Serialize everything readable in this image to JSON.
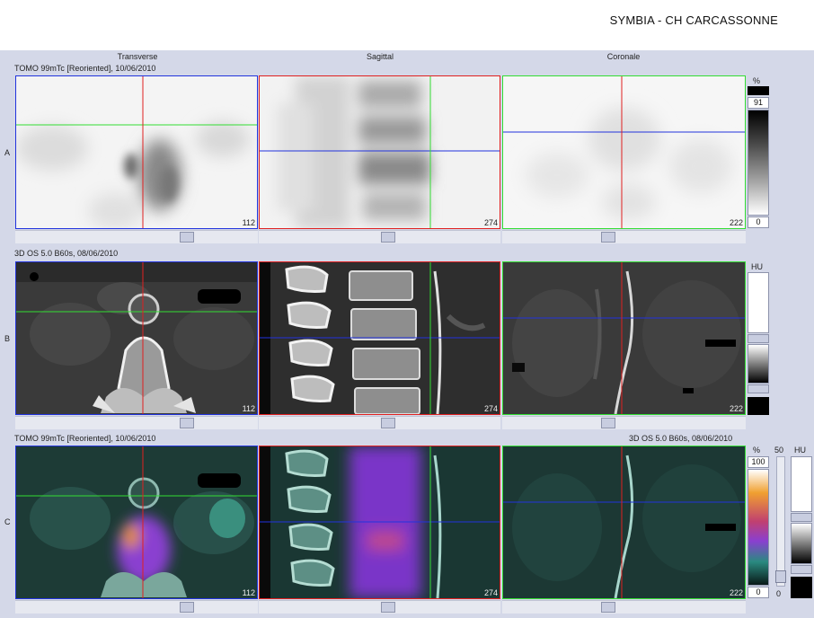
{
  "header": {
    "hospital": "SYMBIA - CH CARCASSONNE"
  },
  "columns": [
    "Transverse",
    "Sagittal",
    "Coronale"
  ],
  "rows": [
    {
      "label": "A",
      "series_left": "TOMO 99mTc [Reoriented], 10/06/2010",
      "series_right": "",
      "slices": [
        "112",
        "274",
        "222"
      ],
      "scale_unit": "%",
      "scale_top": "91",
      "scale_bottom": "0"
    },
    {
      "label": "B",
      "series_left": "3D  OS  5.0  B60s, 08/06/2010",
      "series_right": "",
      "slices": [
        "112",
        "274",
        "222"
      ],
      "scale_unit": "HU"
    },
    {
      "label": "C",
      "series_left": "TOMO 99mTc [Reoriented], 10/06/2010",
      "series_right": "3D  OS  5.0  B60s, 08/06/2010",
      "slices": [
        "112",
        "274",
        "222"
      ],
      "scale_unit": "%",
      "scale_top": "100",
      "scale_bottom": "0",
      "slider_top": "50",
      "slider_bottom": "0",
      "scale_unit_2": "HU"
    }
  ],
  "colors": {
    "crosshair_red": "#e02020",
    "crosshair_green": "#33dd33",
    "crosshair_blue": "#2233dd",
    "background": "#d4d8e8"
  }
}
